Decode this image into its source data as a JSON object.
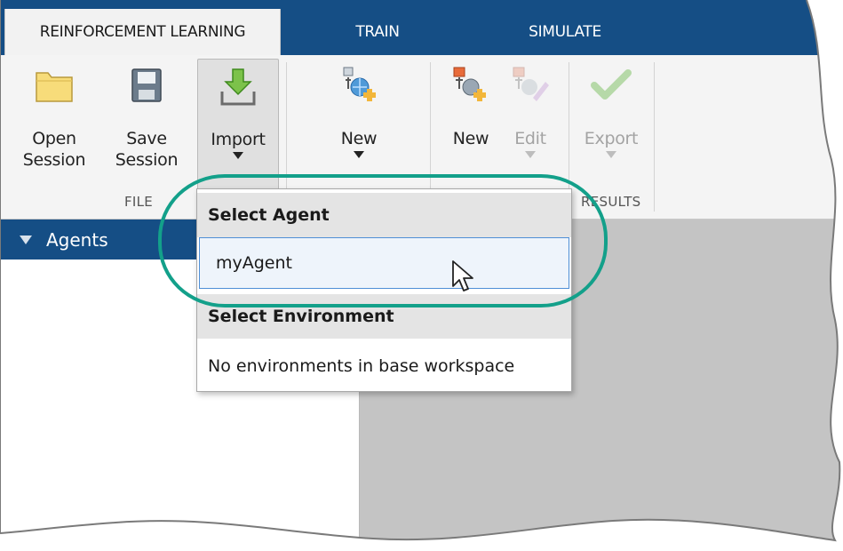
{
  "tabs": [
    {
      "label": "REINFORCEMENT LEARNING",
      "active": true
    },
    {
      "label": "TRAIN",
      "active": false
    },
    {
      "label": "SIMULATE",
      "active": false
    }
  ],
  "ribbon": {
    "open_session": {
      "line1": "Open",
      "line2": "Session",
      "icon": "folder-icon"
    },
    "save_session": {
      "line1": "Save",
      "line2": "Session",
      "icon": "save-icon"
    },
    "import": {
      "label": "Import",
      "icon": "import-arrow-icon",
      "pressed": true
    },
    "new_env": {
      "label": "New",
      "icon": "new-environment-icon"
    },
    "new_agent": {
      "label": "New",
      "icon": "new-agent-icon"
    },
    "edit": {
      "label": "Edit",
      "icon": "edit-agent-icon",
      "enabled": false
    },
    "export": {
      "label": "Export",
      "icon": "checkmark-icon",
      "enabled": false
    },
    "groups": {
      "file": "FILE",
      "results": "RESULTS"
    }
  },
  "panels": {
    "agents": "Agents"
  },
  "dropdown": {
    "section_agent": "Select Agent",
    "agent_items": [
      "myAgent"
    ],
    "section_environment": "Select Environment",
    "environment_message": "No environments in base workspace"
  },
  "colors": {
    "tab_bar": "#154e85",
    "highlight": "#13a08a",
    "hover_border": "#4f8fd6"
  }
}
